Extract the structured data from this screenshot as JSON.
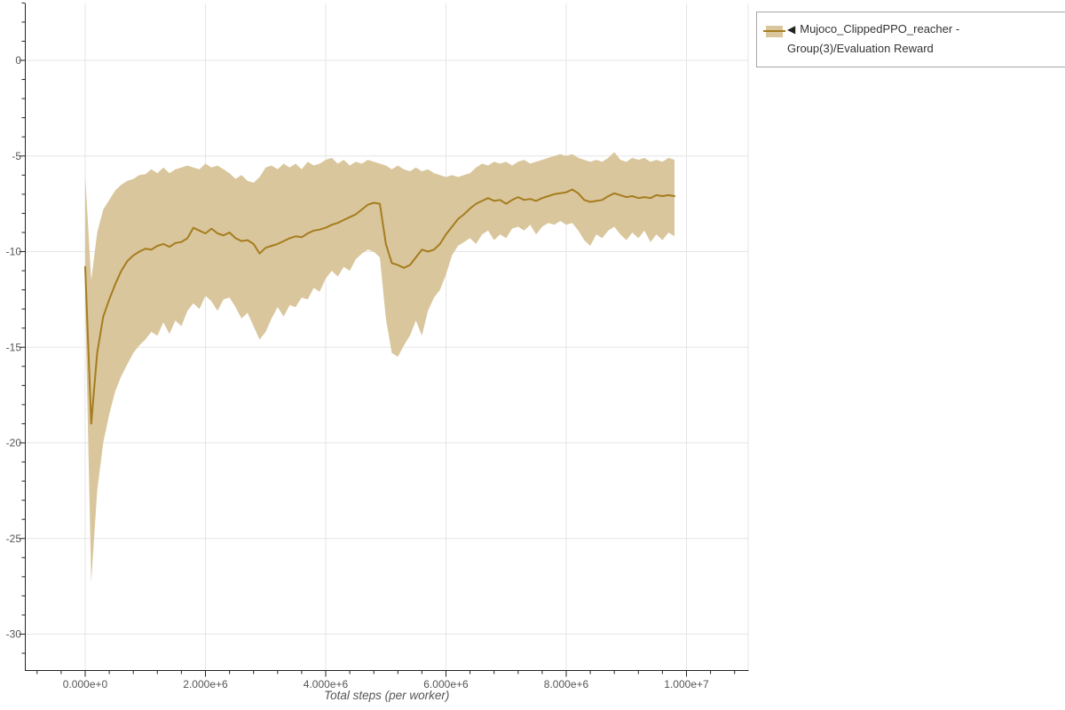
{
  "window": {
    "background": "#ffffff"
  },
  "legend": {
    "expander_icon": "◀",
    "label": "Mujoco_ClippedPPO_reacher - Group(3)/Evaluation Reward",
    "border_color": "#a5a5a5",
    "text_color": "#333333"
  },
  "chart_data": {
    "type": "line",
    "title": "",
    "xlabel": "Total steps (per worker)",
    "ylabel": "",
    "x_unit": "steps",
    "xlim_e6": [
      -1.0,
      11.0
    ],
    "ylim": [
      -31.9,
      3.0
    ],
    "grid": true,
    "legend_position": "top-right",
    "x_ticks": {
      "values_e6": [
        0,
        2,
        4,
        6,
        8,
        10
      ],
      "labels": [
        "0.000e+0",
        "2.000e+6",
        "4.000e+6",
        "6.000e+6",
        "8.000e+6",
        "1.000e+7"
      ],
      "minor_step_e6": 0.4
    },
    "y_ticks": {
      "values": [
        0,
        -5,
        -10,
        -15,
        -20,
        -25,
        -30
      ],
      "labels": [
        "0",
        "-5",
        "-10",
        "-15",
        "-20",
        "-25",
        "-30"
      ],
      "minor_step": 1
    },
    "colors": {
      "grid": "#e5e5e5",
      "axis": "#222222",
      "tick_label": "#555555",
      "axis_label": "#555555"
    },
    "series": [
      {
        "name": "Mujoco_ClippedPPO_reacher - Group(3)/Evaluation Reward",
        "line_color": "#a67c1e",
        "band_color": "#d9c69c",
        "x_start_e6": 0.0,
        "x_step_e6": 0.1,
        "mean": [
          -10.8,
          -19.0,
          -15.3,
          -13.4,
          -12.5,
          -11.7,
          -11.0,
          -10.5,
          -10.2,
          -10.0,
          -9.85,
          -9.9,
          -9.7,
          -9.6,
          -9.75,
          -9.55,
          -9.5,
          -9.3,
          -8.75,
          -8.9,
          -9.05,
          -8.8,
          -9.05,
          -9.15,
          -9.0,
          -9.3,
          -9.45,
          -9.4,
          -9.6,
          -10.1,
          -9.8,
          -9.7,
          -9.6,
          -9.45,
          -9.3,
          -9.2,
          -9.25,
          -9.05,
          -8.9,
          -8.85,
          -8.75,
          -8.6,
          -8.5,
          -8.35,
          -8.2,
          -8.05,
          -7.8,
          -7.55,
          -7.45,
          -7.5,
          -9.6,
          -10.6,
          -10.7,
          -10.85,
          -10.7,
          -10.3,
          -9.9,
          -10.0,
          -9.9,
          -9.6,
          -9.1,
          -8.7,
          -8.3,
          -8.05,
          -7.75,
          -7.5,
          -7.35,
          -7.2,
          -7.35,
          -7.3,
          -7.5,
          -7.3,
          -7.15,
          -7.3,
          -7.25,
          -7.35,
          -7.2,
          -7.1,
          -7.0,
          -6.95,
          -6.9,
          -6.75,
          -6.95,
          -7.3,
          -7.4,
          -7.35,
          -7.3,
          -7.1,
          -6.95,
          -7.05,
          -7.15,
          -7.1,
          -7.2,
          -7.15,
          -7.2,
          -7.05,
          -7.1,
          -7.05,
          -7.1
        ],
        "lower": [
          -12.5,
          -27.3,
          -22.5,
          -20.0,
          -18.5,
          -17.3,
          -16.5,
          -15.9,
          -15.3,
          -14.9,
          -14.6,
          -14.2,
          -14.4,
          -13.7,
          -14.3,
          -13.6,
          -13.9,
          -13.1,
          -12.7,
          -13.0,
          -12.3,
          -12.6,
          -13.1,
          -12.5,
          -12.4,
          -12.9,
          -13.5,
          -13.2,
          -13.9,
          -14.6,
          -14.2,
          -13.5,
          -12.9,
          -13.4,
          -12.8,
          -12.9,
          -12.4,
          -12.5,
          -11.9,
          -12.1,
          -11.4,
          -11.0,
          -11.3,
          -10.8,
          -11.0,
          -10.4,
          -10.1,
          -9.9,
          -10.0,
          -10.3,
          -13.5,
          -15.3,
          -15.5,
          -14.9,
          -14.4,
          -13.6,
          -14.4,
          -13.1,
          -12.4,
          -12.0,
          -11.2,
          -10.2,
          -9.7,
          -9.5,
          -9.3,
          -9.6,
          -9.1,
          -8.9,
          -9.4,
          -9.1,
          -9.3,
          -8.8,
          -8.7,
          -8.9,
          -8.6,
          -9.1,
          -8.7,
          -8.5,
          -8.6,
          -8.4,
          -8.6,
          -8.5,
          -8.9,
          -9.4,
          -9.7,
          -9.1,
          -9.3,
          -8.9,
          -8.7,
          -9.1,
          -9.4,
          -9.0,
          -9.3,
          -8.9,
          -9.5,
          -9.1,
          -9.4,
          -9.0,
          -9.2
        ],
        "upper": [
          -6.0,
          -11.5,
          -9.0,
          -7.8,
          -7.3,
          -6.8,
          -6.5,
          -6.3,
          -6.2,
          -6.0,
          -5.95,
          -5.7,
          -5.9,
          -5.6,
          -5.9,
          -5.7,
          -5.6,
          -5.5,
          -5.6,
          -5.7,
          -5.4,
          -5.6,
          -5.5,
          -5.7,
          -5.9,
          -6.2,
          -6.0,
          -6.3,
          -6.4,
          -6.1,
          -5.6,
          -5.5,
          -5.7,
          -5.4,
          -5.6,
          -5.4,
          -5.7,
          -5.3,
          -5.5,
          -5.4,
          -5.2,
          -5.1,
          -5.4,
          -5.2,
          -5.5,
          -5.3,
          -5.4,
          -5.2,
          -5.3,
          -5.4,
          -5.5,
          -5.7,
          -5.5,
          -5.7,
          -5.8,
          -5.6,
          -5.8,
          -5.7,
          -5.9,
          -6.0,
          -6.1,
          -6.0,
          -6.1,
          -6.0,
          -5.9,
          -5.6,
          -5.4,
          -5.5,
          -5.3,
          -5.4,
          -5.3,
          -5.5,
          -5.3,
          -5.2,
          -5.4,
          -5.3,
          -5.2,
          -5.1,
          -5.0,
          -4.9,
          -5.0,
          -4.9,
          -5.1,
          -5.2,
          -5.3,
          -5.2,
          -5.3,
          -5.1,
          -4.8,
          -5.2,
          -5.3,
          -5.1,
          -5.2,
          -5.1,
          -5.3,
          -5.2,
          -5.3,
          -5.1,
          -5.2
        ]
      }
    ]
  }
}
